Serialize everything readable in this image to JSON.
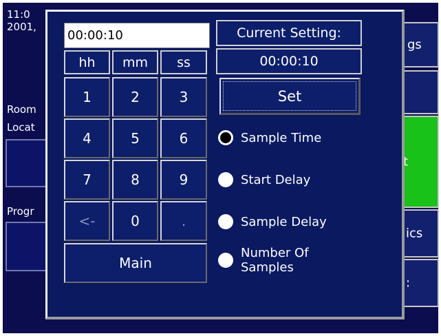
{
  "background": {
    "clock_time": "11:0",
    "clock_date": "2001,",
    "room_label": "Room",
    "location_label": "Locat",
    "program_label": "Progr",
    "settings_button": "gs",
    "green_button": "t",
    "statistics_button": "ics",
    "bottom_right_button": ":"
  },
  "dialog": {
    "time_entry_value": "00:00:10",
    "units": [
      "hh",
      "mm",
      "ss"
    ],
    "keypad": [
      "1",
      "2",
      "3",
      "4",
      "5",
      "6",
      "7",
      "8",
      "9",
      "<-",
      "0",
      "."
    ],
    "main_button": "Main",
    "current_setting_label": "Current Setting:",
    "current_setting_value": "00:00:10",
    "set_button": "Set",
    "radio_options": [
      {
        "label": "Sample Time",
        "selected": true
      },
      {
        "label": "Start Delay",
        "selected": false
      },
      {
        "label": "Sample Delay",
        "selected": false
      },
      {
        "label": "Number Of\nSamples",
        "selected": false
      }
    ]
  },
  "colors": {
    "screen_bg": "#0b0d4f",
    "dialog_bg": "#0a1960",
    "green_button": "#19c219"
  }
}
